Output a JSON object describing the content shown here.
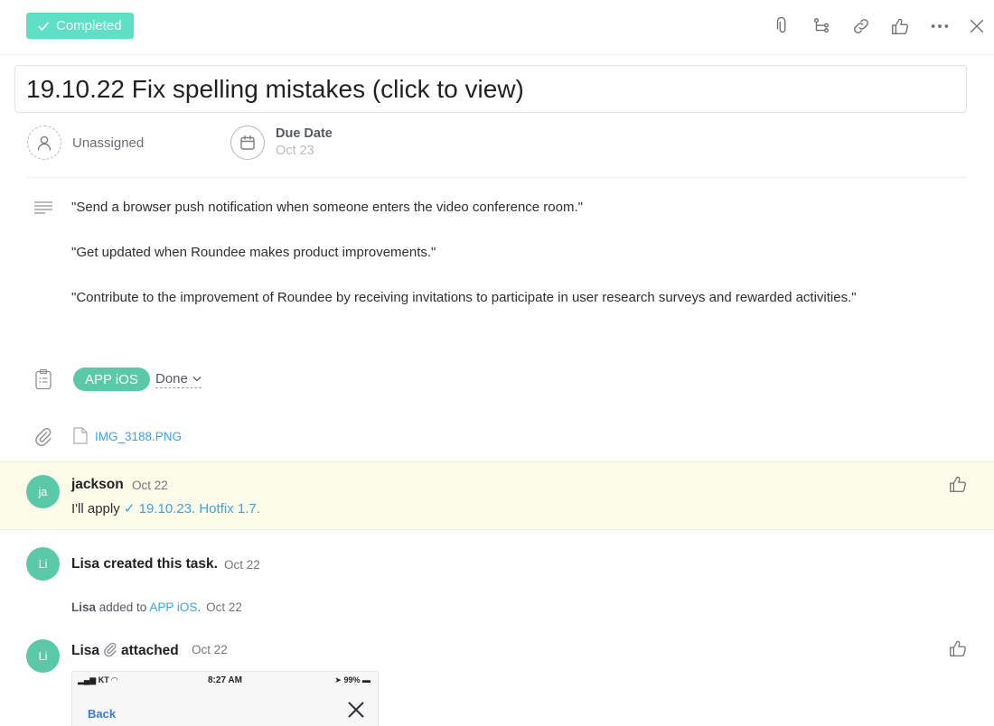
{
  "header": {
    "status_label": "Completed",
    "accent": "#5fe0c6",
    "icons": [
      "paperclip-icon",
      "subtask-icon",
      "link-icon",
      "thumbs-up-icon",
      "more-icon",
      "close-icon"
    ]
  },
  "task": {
    "title": "19.10.22 Fix spelling mistakes (click to view)",
    "assignee": "Unassigned",
    "due_date_label": "Due Date",
    "due_date_value": "Oct 23",
    "description": [
      "\"Send a browser push notification when someone enters the video conference room.\"",
      "\"Get updated when Roundee makes product improvements.\"",
      "\"Contribute to the improvement of Roundee by receiving invitations to participate in user research surveys and rewarded activities.\""
    ],
    "project": {
      "name": "APP iOS",
      "status": "Done",
      "color": "#5bc8a8"
    },
    "attachment": "IMG_3188.PNG"
  },
  "activity": {
    "comment": {
      "avatar": "ja",
      "author": "jackson",
      "date": "Oct 22",
      "text_prefix": "I'll apply ",
      "link": "✓ 19.10.23. Hotfix 1.7."
    },
    "created": {
      "avatar": "Li",
      "text": "Lisa created this task.",
      "date": "Oct 22"
    },
    "added": {
      "author": "Lisa",
      "middle": " added to ",
      "project": "APP iOS",
      "suffix": ".",
      "date": "Oct 22"
    },
    "attached": {
      "avatar": "Li",
      "author": "Lisa",
      "action": "attached",
      "date": "Oct 22",
      "preview": {
        "carrier": "KT",
        "time": "8:27 AM",
        "battery": "99%",
        "back_label": "Back"
      }
    }
  }
}
